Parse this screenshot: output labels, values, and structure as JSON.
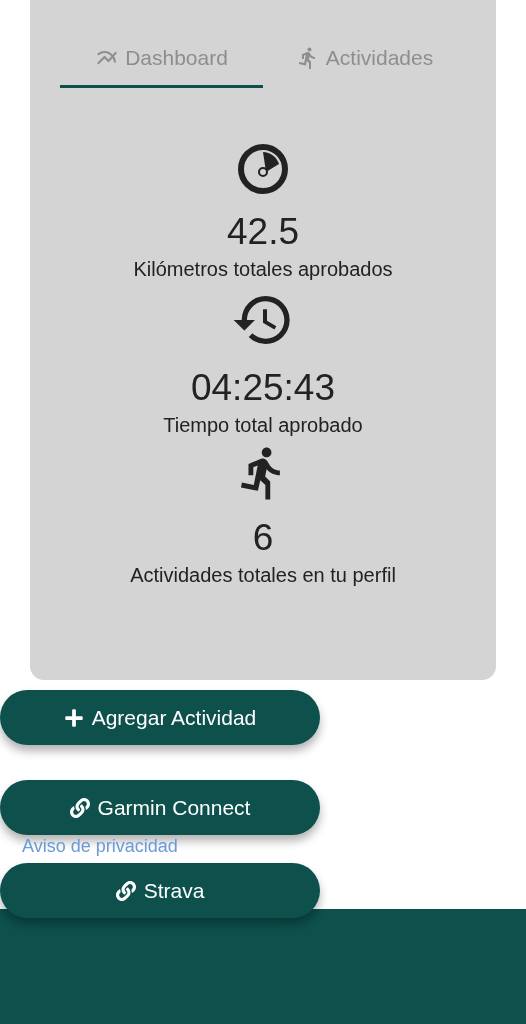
{
  "tabs": [
    {
      "label": "Dashboard",
      "kind": "chart",
      "selected": true
    },
    {
      "label": "Actividades",
      "kind": "run",
      "selected": false
    }
  ],
  "stats": [
    {
      "kind": "gauge",
      "value": "42.5",
      "label": "Kilómetros totales aprobados"
    },
    {
      "kind": "history",
      "value": "04:25:43",
      "label": "Tiempo total aprobado"
    },
    {
      "kind": "run",
      "value": "6",
      "label": "Actividades totales en tu perfil"
    }
  ],
  "buttons": [
    {
      "kind": "add",
      "label": "Agregar Actividad"
    },
    {
      "kind": "link",
      "label": "Garmin Connect"
    },
    {
      "kind": "link",
      "label": "Strava"
    }
  ],
  "privacy_link": "Aviso de privacidad"
}
